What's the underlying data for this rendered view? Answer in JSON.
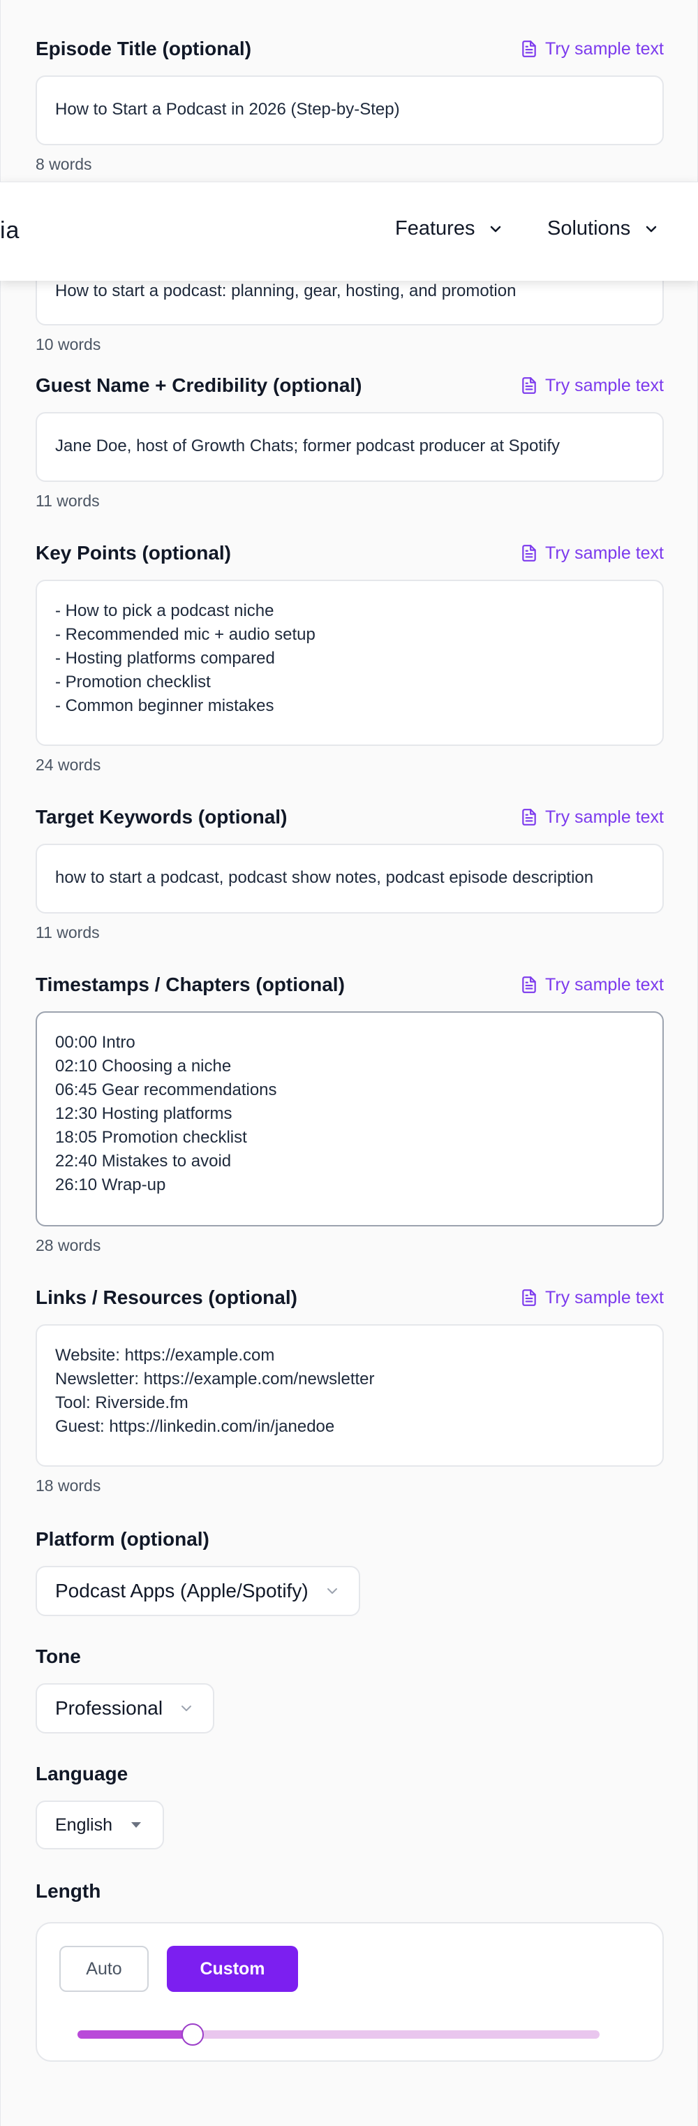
{
  "sample_label": "Try sample text",
  "fields": {
    "episode_title": {
      "label": "Episode Title (optional)",
      "value": "How to Start a Podcast in 2026 (Step-by-Step)",
      "count": "8 words"
    },
    "summary": {
      "value": "How to start a podcast: planning, gear, hosting, and promotion",
      "count": "10 words"
    },
    "guest": {
      "label": "Guest Name + Credibility (optional)",
      "value": "Jane Doe, host of Growth Chats; former podcast producer at Spotify",
      "count": "11 words"
    },
    "key_points": {
      "label": "Key Points (optional)",
      "value": "- How to pick a podcast niche\n- Recommended mic + audio setup\n- Hosting platforms compared\n- Promotion checklist\n- Common beginner mistakes",
      "count": "24 words"
    },
    "keywords": {
      "label": "Target Keywords (optional)",
      "value": "how to start a podcast, podcast show notes, podcast episode description",
      "count": "11 words"
    },
    "timestamps": {
      "label": "Timestamps / Chapters (optional)",
      "value": "00:00 Intro\n02:10 Choosing a niche\n06:45 Gear recommendations\n12:30 Hosting platforms\n18:05 Promotion checklist\n22:40 Mistakes to avoid\n26:10 Wrap-up",
      "count": "28 words"
    },
    "links": {
      "label": "Links / Resources (optional)",
      "value": "Website: https://example.com\nNewsletter: https://example.com/newsletter\nTool: Riverside.fm\nGuest: https://linkedin.com/in/janedoe",
      "count": "18 words"
    }
  },
  "nav": {
    "logo_fragment": "ia",
    "features": "Features",
    "solutions": "Solutions"
  },
  "platform": {
    "label": "Platform (optional)",
    "selected": "Podcast Apps (Apple/Spotify)"
  },
  "tone": {
    "label": "Tone",
    "selected": "Professional"
  },
  "language": {
    "label": "Language",
    "selected": "English"
  },
  "length": {
    "label": "Length",
    "auto_label": "Auto",
    "custom_label": "Custom",
    "mode": "Custom",
    "slider_fraction": 0.22
  },
  "colors": {
    "accent": "#7c3aed",
    "custom_button": "#7c1ff0",
    "slider_fill": "#b94ad9",
    "slider_track": "#e9c6ee"
  }
}
